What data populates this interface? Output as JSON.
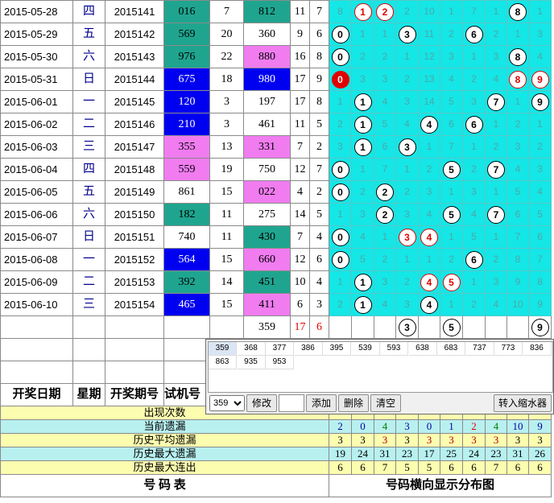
{
  "rows": [
    {
      "date": "2015-05-28",
      "weekday": "四",
      "issue": "2015141",
      "trial": "016",
      "n1": "7",
      "award": "812",
      "s": "11",
      "t": "7",
      "dist": [
        [
          "8",
          ""
        ],
        [
          "1",
          "r"
        ],
        [
          "2",
          "r"
        ],
        [
          "2",
          ""
        ],
        [
          "10",
          ""
        ],
        [
          "1",
          ""
        ],
        [
          "7",
          ""
        ],
        [
          "1",
          ""
        ],
        [
          "8",
          "b"
        ],
        [
          "1",
          ""
        ]
      ]
    },
    {
      "date": "2015-05-29",
      "weekday": "五",
      "issue": "2015142",
      "trial": "569",
      "n1": "20",
      "award": "360",
      "s": "9",
      "t": "6",
      "dist": [
        [
          "0",
          "b"
        ],
        [
          "1",
          ""
        ],
        [
          "1",
          ""
        ],
        [
          "3",
          "b"
        ],
        [
          "11",
          ""
        ],
        [
          "2",
          ""
        ],
        [
          "6",
          "b"
        ],
        [
          "2",
          ""
        ],
        [
          "1",
          ""
        ],
        [
          "3",
          ""
        ]
      ]
    },
    {
      "date": "2015-05-30",
      "weekday": "六",
      "issue": "2015143",
      "trial": "976",
      "n1": "22",
      "award": "880",
      "s": "16",
      "t": "8",
      "dist": [
        [
          "0",
          "b"
        ],
        [
          "2",
          ""
        ],
        [
          "2",
          ""
        ],
        [
          "1",
          ""
        ],
        [
          "12",
          ""
        ],
        [
          "3",
          ""
        ],
        [
          "1",
          ""
        ],
        [
          "3",
          ""
        ],
        [
          "8",
          "b"
        ],
        [
          "4",
          ""
        ]
      ]
    },
    {
      "date": "2015-05-31",
      "weekday": "日",
      "issue": "2015144",
      "trial": "675",
      "n1": "18",
      "award": "980",
      "s": "17",
      "t": "9",
      "dist": [
        [
          "0",
          "s"
        ],
        [
          "3",
          ""
        ],
        [
          "3",
          ""
        ],
        [
          "2",
          ""
        ],
        [
          "13",
          ""
        ],
        [
          "4",
          ""
        ],
        [
          "2",
          ""
        ],
        [
          "4",
          ""
        ],
        [
          "8",
          "r"
        ],
        [
          "9",
          "r"
        ]
      ]
    },
    {
      "date": "2015-06-01",
      "weekday": "一",
      "issue": "2015145",
      "trial": "120",
      "n1": "3",
      "award": "197",
      "s": "17",
      "t": "8",
      "dist": [
        [
          "1",
          ""
        ],
        [
          "1",
          "b"
        ],
        [
          "4",
          ""
        ],
        [
          "3",
          ""
        ],
        [
          "14",
          ""
        ],
        [
          "5",
          ""
        ],
        [
          "3",
          ""
        ],
        [
          "7",
          "b"
        ],
        [
          "1",
          ""
        ],
        [
          "9",
          "b"
        ]
      ]
    },
    {
      "date": "2015-06-02",
      "weekday": "二",
      "issue": "2015146",
      "trial": "210",
      "n1": "3",
      "award": "461",
      "s": "11",
      "t": "5",
      "dist": [
        [
          "2",
          ""
        ],
        [
          "1",
          "b"
        ],
        [
          "5",
          ""
        ],
        [
          "4",
          ""
        ],
        [
          "4",
          "b"
        ],
        [
          "6",
          ""
        ],
        [
          "6",
          "b"
        ],
        [
          "1",
          ""
        ],
        [
          "2",
          ""
        ],
        [
          "1",
          ""
        ]
      ]
    },
    {
      "date": "2015-06-03",
      "weekday": "三",
      "issue": "2015147",
      "trial": "355",
      "n1": "13",
      "award": "331",
      "s": "7",
      "t": "2",
      "dist": [
        [
          "3",
          ""
        ],
        [
          "1",
          "b"
        ],
        [
          "6",
          ""
        ],
        [
          "3",
          "b"
        ],
        [
          "1",
          ""
        ],
        [
          "7",
          ""
        ],
        [
          "1",
          ""
        ],
        [
          "2",
          ""
        ],
        [
          "3",
          ""
        ],
        [
          "2",
          ""
        ]
      ]
    },
    {
      "date": "2015-06-04",
      "weekday": "四",
      "issue": "2015148",
      "trial": "559",
      "n1": "19",
      "award": "750",
      "s": "12",
      "t": "7",
      "dist": [
        [
          "0",
          "b"
        ],
        [
          "1",
          ""
        ],
        [
          "7",
          ""
        ],
        [
          "1",
          ""
        ],
        [
          "2",
          ""
        ],
        [
          "5",
          "b"
        ],
        [
          "2",
          ""
        ],
        [
          "7",
          "b"
        ],
        [
          "4",
          ""
        ],
        [
          "3",
          ""
        ]
      ]
    },
    {
      "date": "2015-06-05",
      "weekday": "五",
      "issue": "2015149",
      "trial": "861",
      "n1": "15",
      "award": "022",
      "s": "4",
      "t": "2",
      "dist": [
        [
          "0",
          "b"
        ],
        [
          "2",
          ""
        ],
        [
          "2",
          "b"
        ],
        [
          "2",
          ""
        ],
        [
          "3",
          ""
        ],
        [
          "1",
          ""
        ],
        [
          "3",
          ""
        ],
        [
          "1",
          ""
        ],
        [
          "5",
          ""
        ],
        [
          "4",
          ""
        ]
      ]
    },
    {
      "date": "2015-06-06",
      "weekday": "六",
      "issue": "2015150",
      "trial": "182",
      "n1": "11",
      "award": "275",
      "s": "14",
      "t": "5",
      "dist": [
        [
          "1",
          ""
        ],
        [
          "3",
          ""
        ],
        [
          "2",
          "b"
        ],
        [
          "3",
          ""
        ],
        [
          "4",
          ""
        ],
        [
          "5",
          "b"
        ],
        [
          "4",
          ""
        ],
        [
          "7",
          "b"
        ],
        [
          "6",
          ""
        ],
        [
          "5",
          ""
        ]
      ]
    },
    {
      "date": "2015-06-07",
      "weekday": "日",
      "issue": "2015151",
      "trial": "740",
      "n1": "11",
      "award": "430",
      "s": "7",
      "t": "4",
      "dist": [
        [
          "0",
          "b"
        ],
        [
          "4",
          ""
        ],
        [
          "1",
          ""
        ],
        [
          "3",
          "r"
        ],
        [
          "4",
          "r"
        ],
        [
          "1",
          ""
        ],
        [
          "5",
          ""
        ],
        [
          "1",
          ""
        ],
        [
          "7",
          ""
        ],
        [
          "6",
          ""
        ]
      ]
    },
    {
      "date": "2015-06-08",
      "weekday": "一",
      "issue": "2015152",
      "trial": "564",
      "n1": "15",
      "award": "660",
      "s": "12",
      "t": "6",
      "dist": [
        [
          "0",
          "b"
        ],
        [
          "5",
          ""
        ],
        [
          "2",
          ""
        ],
        [
          "1",
          ""
        ],
        [
          "1",
          ""
        ],
        [
          "2",
          ""
        ],
        [
          "6",
          "b"
        ],
        [
          "2",
          ""
        ],
        [
          "8",
          ""
        ],
        [
          "7",
          ""
        ]
      ]
    },
    {
      "date": "2015-06-09",
      "weekday": "二",
      "issue": "2015153",
      "trial": "392",
      "n1": "14",
      "award": "451",
      "s": "10",
      "t": "4",
      "dist": [
        [
          "1",
          ""
        ],
        [
          "1",
          "b"
        ],
        [
          "3",
          ""
        ],
        [
          "2",
          ""
        ],
        [
          "4",
          "r"
        ],
        [
          "5",
          "r"
        ],
        [
          "1",
          ""
        ],
        [
          "3",
          ""
        ],
        [
          "9",
          ""
        ],
        [
          "8",
          ""
        ]
      ]
    },
    {
      "date": "2015-06-10",
      "weekday": "三",
      "issue": "2015154",
      "trial": "465",
      "n1": "15",
      "award": "411",
      "s": "6",
      "t": "3",
      "dist": [
        [
          "2",
          ""
        ],
        [
          "1",
          "b"
        ],
        [
          "4",
          ""
        ],
        [
          "3",
          ""
        ],
        [
          "4",
          "b"
        ],
        [
          "1",
          ""
        ],
        [
          "2",
          ""
        ],
        [
          "4",
          ""
        ],
        [
          "10",
          ""
        ],
        [
          "9",
          ""
        ]
      ]
    }
  ],
  "pending": {
    "award": "359",
    "s": "17",
    "t": "6",
    "balls": [
      [
        "",
        "",
        ""
      ],
      [
        "",
        "",
        ""
      ],
      [
        "",
        "",
        ""
      ],
      [
        "3",
        "b"
      ],
      [
        "",
        ""
      ],
      [
        "5",
        "b"
      ],
      [
        "",
        ""
      ],
      [
        "",
        ""
      ],
      [
        "",
        ""
      ],
      [
        "9",
        "b"
      ]
    ]
  },
  "header": {
    "date": "开奖日期",
    "weekday": "星期",
    "issue": "开奖期号",
    "trial": "试机号"
  },
  "stats": [
    {
      "label": "出现次数",
      "values": []
    },
    {
      "label": "当前遗漏",
      "values": [
        "2",
        "0",
        "4",
        "3",
        "0",
        "1",
        "2",
        "4",
        "10",
        "9"
      ]
    },
    {
      "label": "历史平均遗漏",
      "values": [
        "3",
        "3",
        "3",
        "3",
        "3",
        "3",
        "3",
        "3",
        "3",
        "3"
      ]
    },
    {
      "label": "历史最大遗漏",
      "values": [
        "19",
        "24",
        "31",
        "23",
        "17",
        "25",
        "24",
        "23",
        "31",
        "26"
      ]
    },
    {
      "label": "历史最大连出",
      "values": [
        "6",
        "6",
        "7",
        "5",
        "5",
        "6",
        "6",
        "7",
        "6",
        "6"
      ]
    }
  ],
  "footer": {
    "left": "号  码  表",
    "right": "号码横向显示分布图"
  },
  "popup": {
    "numbers": [
      "359",
      "368",
      "377",
      "386",
      "395",
      "539",
      "593",
      "638",
      "683",
      "737",
      "773",
      "836",
      "863",
      "935",
      "953"
    ],
    "select": "359",
    "buttons": {
      "modify": "修改",
      "add": "添加",
      "delete": "删除",
      "clear": "清空",
      "shrink": "转入缩水器"
    }
  },
  "colors": {
    "teal": "#1fa58f",
    "blue": "#0000f0",
    "pink": "#f07cf0",
    "cyan": "#15e6e6",
    "red": "#e00000"
  }
}
